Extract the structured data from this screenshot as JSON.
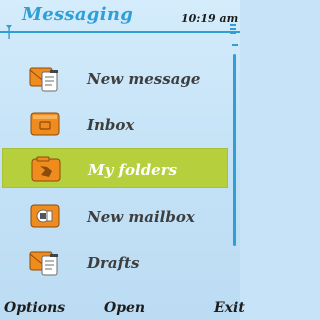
{
  "header": {
    "title": "Messaging",
    "clock": "10:19 am"
  },
  "menu": {
    "items": [
      {
        "label": "New message",
        "icon": "new-message-icon",
        "selected": false
      },
      {
        "label": "Inbox",
        "icon": "inbox-icon",
        "selected": false
      },
      {
        "label": "My folders",
        "icon": "folders-icon",
        "selected": true
      },
      {
        "label": "New mailbox",
        "icon": "mailbox-icon",
        "selected": false
      },
      {
        "label": "Drafts",
        "icon": "drafts-icon",
        "selected": false
      }
    ]
  },
  "softkeys": {
    "left": "Options",
    "middle": "Open",
    "right": "Exit"
  },
  "colors": {
    "accent": "#2f9fd6",
    "selection": "#b6cf3c",
    "background": "#c6e3f7",
    "icon_orange": "#f08c1e"
  }
}
